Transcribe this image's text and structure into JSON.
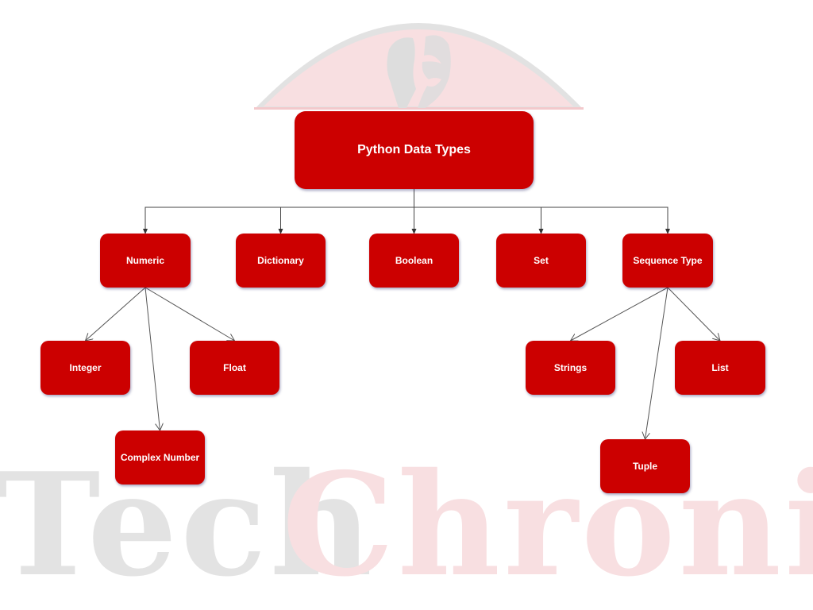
{
  "watermark": {
    "left_word": "Tech",
    "right_word": "Chronicle",
    "emblem": "mask-emblem"
  },
  "colors": {
    "node_fill": "#cc0000",
    "node_text": "#ffffff",
    "connector": "#555555",
    "watermark_gray": "#e3e3e3",
    "watermark_pink": "#f8dfe1"
  },
  "diagram": {
    "root": {
      "id": "python-data-types",
      "label": "Python Data Types"
    },
    "level1": [
      {
        "id": "numeric",
        "label": "Numeric"
      },
      {
        "id": "dictionary",
        "label": "Dictionary"
      },
      {
        "id": "boolean",
        "label": "Boolean"
      },
      {
        "id": "set",
        "label": "Set"
      },
      {
        "id": "sequence-type",
        "label": "Sequence Type"
      }
    ],
    "numeric_children": [
      {
        "id": "integer",
        "label": "Integer"
      },
      {
        "id": "float",
        "label": "Float"
      },
      {
        "id": "complex-number",
        "label": "Complex Number"
      }
    ],
    "sequence_children": [
      {
        "id": "strings",
        "label": "Strings"
      },
      {
        "id": "list",
        "label": "List"
      },
      {
        "id": "tuple",
        "label": "Tuple"
      }
    ],
    "edges": [
      [
        "python-data-types",
        "numeric"
      ],
      [
        "python-data-types",
        "dictionary"
      ],
      [
        "python-data-types",
        "boolean"
      ],
      [
        "python-data-types",
        "set"
      ],
      [
        "python-data-types",
        "sequence-type"
      ],
      [
        "numeric",
        "integer"
      ],
      [
        "numeric",
        "complex-number"
      ],
      [
        "numeric",
        "float"
      ],
      [
        "sequence-type",
        "strings"
      ],
      [
        "sequence-type",
        "tuple"
      ],
      [
        "sequence-type",
        "list"
      ]
    ]
  }
}
